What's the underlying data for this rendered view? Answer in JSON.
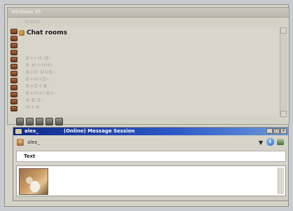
{
  "top_window": {
    "title": "Windows 95",
    "menu": [
      "",
      "Status"
    ],
    "room_label": "Chat rooms",
    "contacts": [
      "B+i-H-IE-",
      "B-H-I-HHI-",
      "B=D-D=B-",
      "B+H+D-",
      "B=Z-I-B-",
      "B+H+I-B=-",
      "B-B-Z-",
      "H-I-H"
    ]
  },
  "message_window": {
    "title_name": "alex_",
    "title_status": "(Online) Message Session",
    "title_buttons": [
      "_",
      "□",
      "x"
    ],
    "toolbar_name": "alex_",
    "dropdown": "▼",
    "info_icon": "i",
    "text_label": "Text"
  },
  "colors": {
    "title_bar": "#2e5ac8",
    "window_bg": "#d6d3c9",
    "field_bg": "#ffffff"
  }
}
